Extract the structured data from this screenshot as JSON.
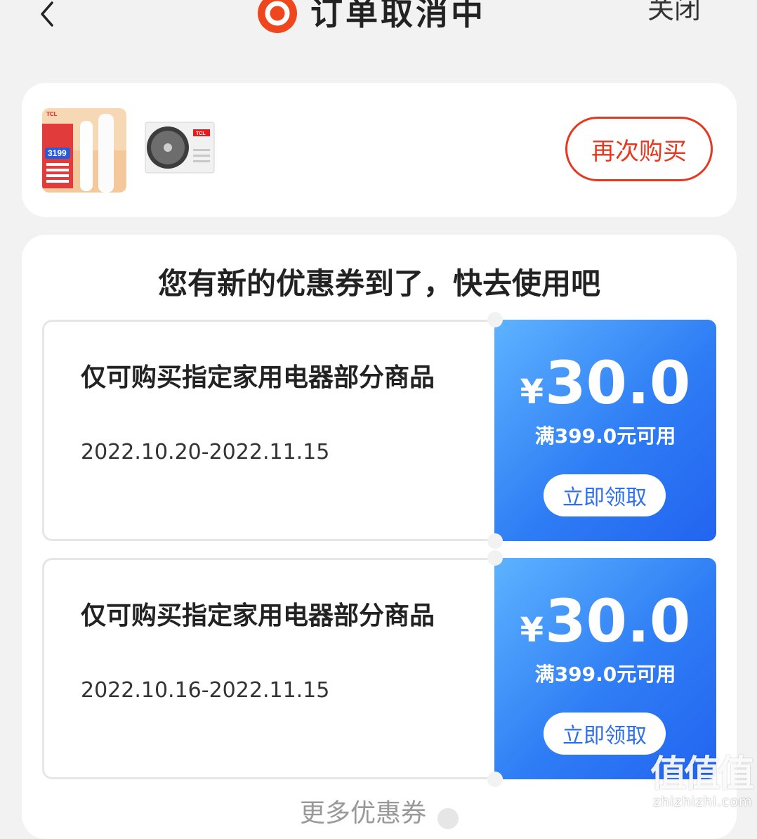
{
  "header": {
    "title": "订单取消中",
    "close_label": "关闭"
  },
  "order": {
    "thumb1_badge": "TCL",
    "thumb1_price": "3199",
    "thumb2_badge": "TCL",
    "rebuy_label": "再次购买"
  },
  "coupons_section": {
    "title": "您有新的优惠券到了，快去使用吧",
    "coupons": [
      {
        "description": "仅可购买指定家用电器部分商品",
        "date_range": "2022.10.20-2022.11.15",
        "currency": "¥",
        "amount": "30.0",
        "threshold": "满399.0元可用",
        "claim_label": "立即领取"
      },
      {
        "description": "仅可购买指定家用电器部分商品",
        "date_range": "2022.10.16-2022.11.15",
        "currency": "¥",
        "amount": "30.0",
        "threshold": "满399.0元可用",
        "claim_label": "立即领取"
      }
    ],
    "more_label": "更多优惠券"
  },
  "watermark": {
    "glyphs": "值值值",
    "site": "zhizhizhi.com"
  },
  "colors": {
    "accent_red": "#e8371f",
    "coupon_blue": "#2f7df5",
    "background": "#f2f2f2"
  },
  "icons": [
    "back-arrow-icon",
    "brand-logo-icon",
    "more-chevron-icon"
  ]
}
